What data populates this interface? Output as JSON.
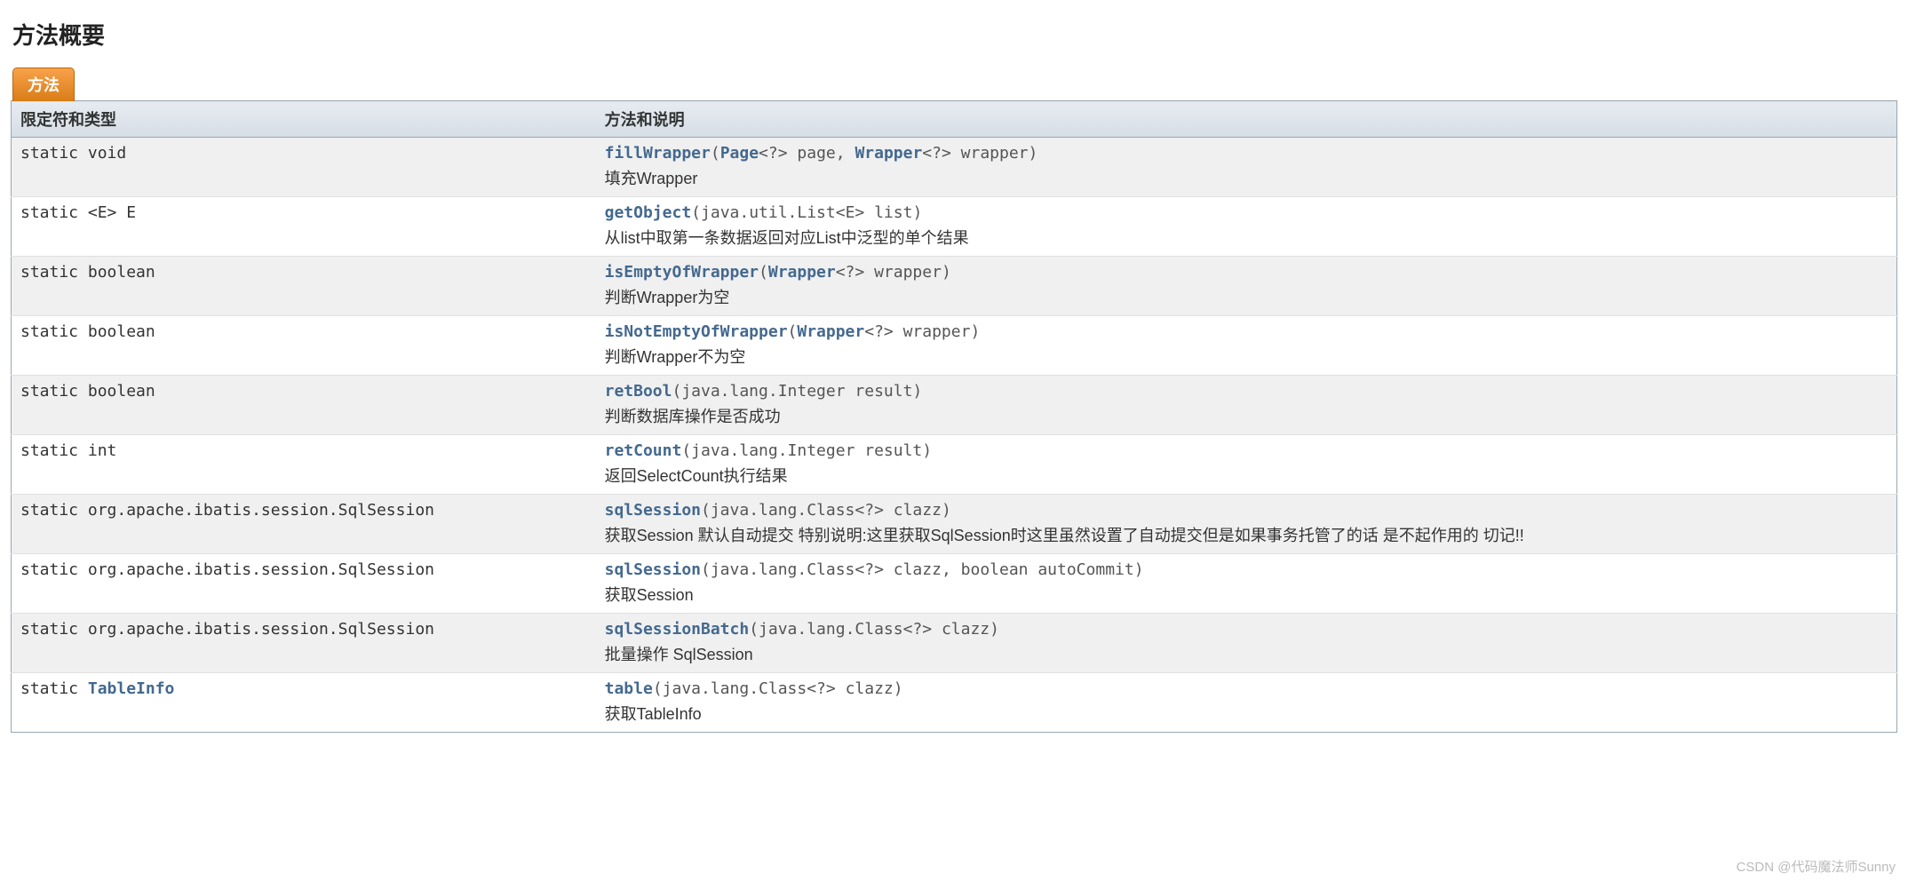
{
  "section_title": "方法概要",
  "tab_label": "方法",
  "headers": {
    "type": "限定符和类型",
    "desc": "方法和说明"
  },
  "methods": [
    {
      "modifiers": "static void",
      "type_link": null,
      "name": "fillWrapper",
      "params": [
        {
          "type": "Page",
          "generic": "<?>",
          "ident": "page",
          "link": true
        },
        {
          "type": "Wrapper",
          "generic": "<?>",
          "ident": "wrapper",
          "link": true
        }
      ],
      "desc": "填充Wrapper"
    },
    {
      "modifiers": "static <E> E",
      "type_link": null,
      "name": "getObject",
      "params": [
        {
          "type": "java.util.List",
          "generic": "<E>",
          "ident": "list",
          "link": false
        }
      ],
      "desc": "从list中取第一条数据返回对应List中泛型的单个结果"
    },
    {
      "modifiers": "static boolean",
      "type_link": null,
      "name": "isEmptyOfWrapper",
      "params": [
        {
          "type": "Wrapper",
          "generic": "<?>",
          "ident": "wrapper",
          "link": true
        }
      ],
      "desc": "判断Wrapper为空"
    },
    {
      "modifiers": "static boolean",
      "type_link": null,
      "name": "isNotEmptyOfWrapper",
      "params": [
        {
          "type": "Wrapper",
          "generic": "<?>",
          "ident": "wrapper",
          "link": true
        }
      ],
      "desc": "判断Wrapper不为空"
    },
    {
      "modifiers": "static boolean",
      "type_link": null,
      "name": "retBool",
      "params": [
        {
          "type": "java.lang.Integer",
          "generic": "",
          "ident": "result",
          "link": false
        }
      ],
      "desc": "判断数据库操作是否成功"
    },
    {
      "modifiers": "static int",
      "type_link": null,
      "name": "retCount",
      "params": [
        {
          "type": "java.lang.Integer",
          "generic": "",
          "ident": "result",
          "link": false
        }
      ],
      "desc": "返回SelectCount执行结果"
    },
    {
      "modifiers": "static org.apache.ibatis.session.SqlSession",
      "type_link": null,
      "name": "sqlSession",
      "params": [
        {
          "type": "java.lang.Class",
          "generic": "<?>",
          "ident": "clazz",
          "link": false
        }
      ],
      "desc": "获取Session 默认自动提交 特别说明:这里获取SqlSession时这里虽然设置了自动提交但是如果事务托管了的话 是不起作用的 切记!!"
    },
    {
      "modifiers": "static org.apache.ibatis.session.SqlSession",
      "type_link": null,
      "name": "sqlSession",
      "params": [
        {
          "type": "java.lang.Class",
          "generic": "<?>",
          "ident": "clazz",
          "link": false
        },
        {
          "type": "boolean",
          "generic": "",
          "ident": "autoCommit",
          "link": false
        }
      ],
      "desc": "获取Session"
    },
    {
      "modifiers": "static org.apache.ibatis.session.SqlSession",
      "type_link": null,
      "name": "sqlSessionBatch",
      "params": [
        {
          "type": "java.lang.Class",
          "generic": "<?>",
          "ident": "clazz",
          "link": false
        }
      ],
      "desc": "批量操作 SqlSession"
    },
    {
      "modifiers": "static ",
      "type_link": "TableInfo",
      "name": "table",
      "params": [
        {
          "type": "java.lang.Class",
          "generic": "<?>",
          "ident": "clazz",
          "link": false
        }
      ],
      "desc": "获取TableInfo"
    }
  ],
  "watermark": "CSDN @代码魔法师Sunny"
}
